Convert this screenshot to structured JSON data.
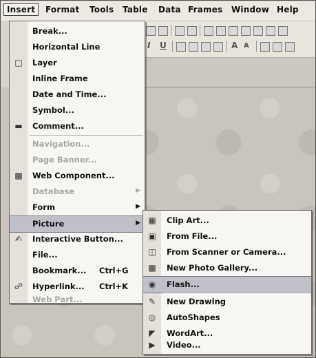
{
  "menubar": [
    {
      "label": "Insert",
      "active": true
    },
    {
      "label": "Format"
    },
    {
      "label": "Tools"
    },
    {
      "label": "Table"
    },
    {
      "label": "Data"
    },
    {
      "label": "Frames"
    },
    {
      "label": "Window"
    },
    {
      "label": "Help"
    }
  ],
  "toolbar": {
    "bold_italic": "I",
    "underline": "U",
    "grow_font": "A",
    "shrink_font": "A"
  },
  "insert_menu": [
    {
      "label": "Break...",
      "icon": ""
    },
    {
      "label": "Horizontal Line",
      "icon": ""
    },
    {
      "label": "Layer",
      "icon": "layer-icon"
    },
    {
      "label": "Inline Frame",
      "icon": ""
    },
    {
      "label": "Date and Time...",
      "icon": ""
    },
    {
      "label": "Symbol...",
      "icon": ""
    },
    {
      "label": "Comment...",
      "icon": "comment-icon"
    },
    {
      "label": "Navigation...",
      "disabled": true
    },
    {
      "label": "Page Banner...",
      "disabled": true
    },
    {
      "label": "Web Component...",
      "icon": "web-component-icon"
    },
    {
      "label": "Database",
      "disabled": true,
      "submenu": true
    },
    {
      "label": "Form",
      "submenu": true
    },
    {
      "label": "Picture",
      "submenu": true,
      "highlighted": true
    },
    {
      "label": "Interactive Button...",
      "icon": "interactive-button-icon"
    },
    {
      "label": "File...",
      "icon": ""
    },
    {
      "label": "Bookmark...",
      "shortcut": "Ctrl+G"
    },
    {
      "label": "Hyperlink...",
      "shortcut": "Ctrl+K",
      "icon": "hyperlink-icon"
    },
    {
      "label": "Web Part...",
      "disabled": true
    }
  ],
  "picture_submenu": [
    {
      "label": "Clip Art...",
      "icon": "clip-art-icon"
    },
    {
      "label": "From File...",
      "icon": "from-file-icon"
    },
    {
      "label": "From Scanner or Camera...",
      "icon": "scanner-icon"
    },
    {
      "label": "New Photo Gallery...",
      "icon": "photo-gallery-icon"
    },
    {
      "label": "Flash...",
      "icon": "flash-icon",
      "highlighted": true
    },
    {
      "label": "New Drawing",
      "icon": "drawing-icon"
    },
    {
      "label": "AutoShapes",
      "icon": "autoshapes-icon"
    },
    {
      "label": "WordArt...",
      "icon": "wordart-icon"
    },
    {
      "label": "Video...",
      "icon": "video-icon"
    }
  ],
  "colors": {
    "menu_bg": "#f7f6f3",
    "highlight": "#bfc0c8",
    "disabled_text": "#a9a7a2"
  }
}
